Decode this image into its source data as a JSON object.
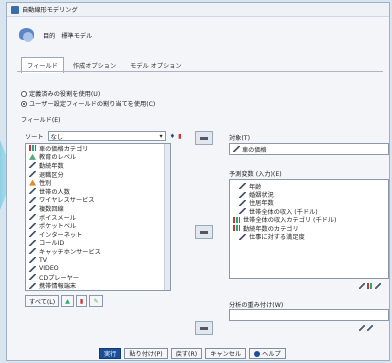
{
  "window": {
    "title": "自動線形モデリング"
  },
  "header": {
    "goal_label": "目的",
    "goal_value": "標準モデル"
  },
  "tabs": [
    {
      "label": "フィールド",
      "active": true
    },
    {
      "label": "作成オプション",
      "active": false
    },
    {
      "label": "モデル オプション",
      "active": false
    }
  ],
  "role_options": [
    {
      "label": "定義済みの役割を使用(U)",
      "selected": false
    },
    {
      "label": "ユーザー設定フィールドの割り当てを使用(C)",
      "selected": true
    }
  ],
  "fields": {
    "label": "フィールド(E)",
    "sort_label": "ソート",
    "sort_value": "なし",
    "items": [
      {
        "icon": "bars",
        "label": "車の価格カテゴリ"
      },
      {
        "icon": "tri",
        "label": "教育のレベル"
      },
      {
        "icon": "pencil",
        "label": "勤続年数"
      },
      {
        "icon": "pencil",
        "label": "退職区分"
      },
      {
        "icon": "orange",
        "label": "性別"
      },
      {
        "icon": "pencil",
        "label": "世帯の人数"
      },
      {
        "icon": "pencil",
        "label": "ワイヤレスサービス"
      },
      {
        "icon": "pencil",
        "label": "複数回線"
      },
      {
        "icon": "pencil",
        "label": "ボイスメール"
      },
      {
        "icon": "pencil",
        "label": "ポケットベル"
      },
      {
        "icon": "pencil",
        "label": "インターネット"
      },
      {
        "icon": "pencil",
        "label": "コールID"
      },
      {
        "icon": "pencil",
        "label": "キャッチホンサービス"
      },
      {
        "icon": "pencil",
        "label": "TV"
      },
      {
        "icon": "pencil",
        "label": "VIDEO"
      },
      {
        "icon": "pencil",
        "label": "CDプレーヤー"
      },
      {
        "icon": "pencil",
        "label": "携帯情報端末"
      },
      {
        "icon": "pencil",
        "label": "PC"
      }
    ]
  },
  "list_buttons": {
    "all_label": "すべて(L)"
  },
  "target": {
    "label": "対象(T)",
    "value": "車の価格"
  },
  "predictors": {
    "label": "予測変数 (入力)(E)",
    "items": [
      {
        "icon": "pencil",
        "label": "年齢",
        "inner": true
      },
      {
        "icon": "pencil",
        "label": "婚姻状況",
        "inner": true
      },
      {
        "icon": "pencil",
        "label": "住居年数",
        "inner": true
      },
      {
        "icon": "pencil",
        "label": "世帯全体の収入 (千ドル)",
        "inner": true
      },
      {
        "icon": "bars",
        "label": "世帯全体の収入カテゴリ (千ドル)",
        "inner": false
      },
      {
        "icon": "bars",
        "label": "勤続年数のカテゴリ",
        "inner": false
      },
      {
        "icon": "pencil",
        "label": "仕事に対する満足度",
        "inner": true
      }
    ]
  },
  "weight": {
    "label": "分析の重み付け(W)",
    "value": ""
  },
  "footer": {
    "run_label": "実行",
    "ok_label": "貼り付け(P)",
    "reset_label": "戻す(R)",
    "cancel_label": "キャンセル",
    "help_label": "ヘルプ"
  },
  "colors": {
    "primary": "#1a4f9a",
    "background": "#d8e4ef"
  }
}
